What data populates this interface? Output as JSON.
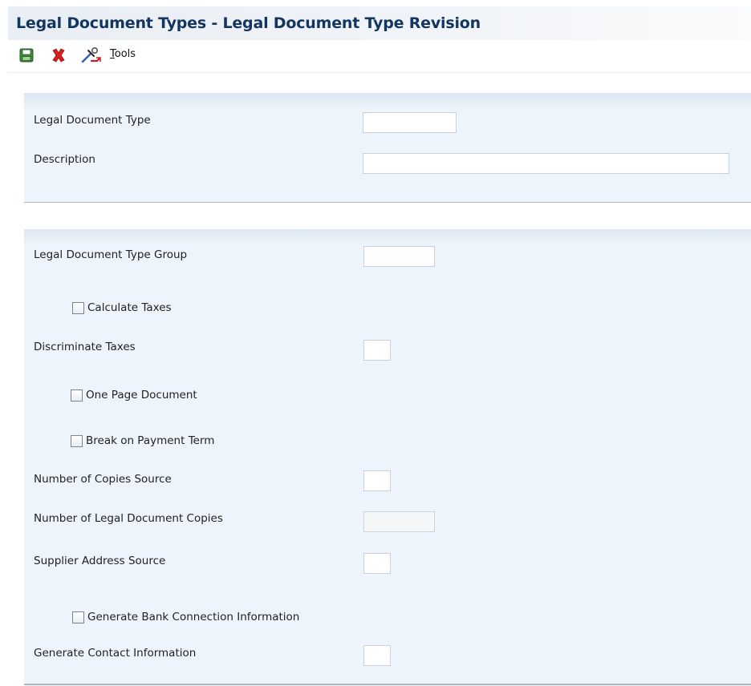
{
  "page": {
    "title": "Legal Document Types - Legal Document Type Revision"
  },
  "toolbar": {
    "save_icon": "save-icon",
    "cancel_icon": "close-icon",
    "tools_icon": "tools-icon",
    "tools_label_first": "T",
    "tools_label_rest": "ools"
  },
  "header_section": {
    "legal_document_type": {
      "label": "Legal Document Type",
      "value": ""
    },
    "description": {
      "label": "Description",
      "value": ""
    }
  },
  "detail_section": {
    "legal_document_type_group": {
      "label": "Legal Document Type Group",
      "value": ""
    },
    "calculate_taxes": {
      "label": "Calculate Taxes",
      "checked": false
    },
    "discriminate_taxes": {
      "label": "Discriminate Taxes",
      "value": ""
    },
    "one_page_document": {
      "label": "One Page Document",
      "checked": false
    },
    "break_on_payment_term": {
      "label": "Break on Payment Term",
      "checked": false
    },
    "number_of_copies_source": {
      "label": "Number of Copies Source",
      "value": ""
    },
    "number_of_legal_document_copies": {
      "label": "Number of Legal Document Copies",
      "value": ""
    },
    "supplier_address_source": {
      "label": "Supplier Address Source",
      "value": ""
    },
    "generate_bank_connection_information": {
      "label": "Generate Bank Connection Information",
      "checked": false
    },
    "generate_contact_information": {
      "label": "Generate Contact Information",
      "value": ""
    }
  },
  "colors": {
    "title_text": "#12365f",
    "panel_bg": "#eef4fb",
    "cancel_red": "#d81e1e",
    "save_green": "#3f8a3a"
  }
}
